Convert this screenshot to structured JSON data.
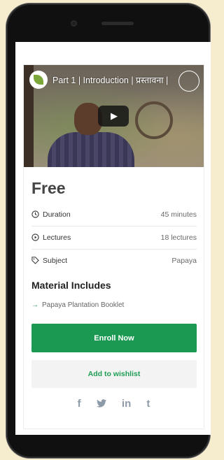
{
  "video": {
    "title": "Part 1 | Introduction | प्रस्तावना |",
    "play_icon": "play-icon"
  },
  "course": {
    "price": "Free",
    "details": [
      {
        "icon": "clock-icon",
        "label": "Duration",
        "value": "45 minutes"
      },
      {
        "icon": "play-circle-icon",
        "label": "Lectures",
        "value": "18 lectures"
      },
      {
        "icon": "tag-icon",
        "label": "Subject",
        "value": "Papaya"
      }
    ]
  },
  "materials": {
    "title": "Material Includes",
    "items": [
      "Papaya Plantation Booklet"
    ]
  },
  "actions": {
    "enroll_label": "Enroll Now",
    "wishlist_label": "Add to wishlist"
  },
  "social": {
    "facebook": "f",
    "twitter": "🐦",
    "linkedin": "in",
    "tumblr": "t"
  },
  "colors": {
    "accent": "#1b9952",
    "background": "#f6ecce"
  }
}
